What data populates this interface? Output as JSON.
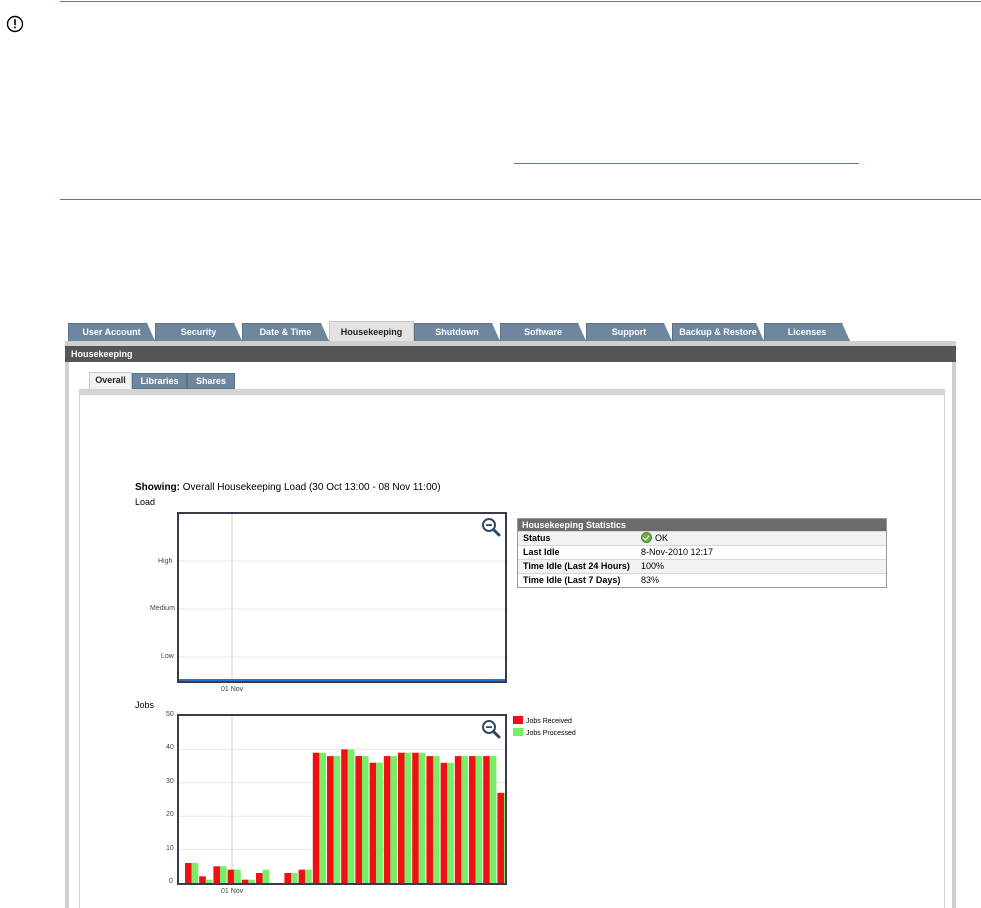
{
  "tabs": [
    "User Account",
    "Security",
    "Date & Time",
    "Housekeeping",
    "Shutdown",
    "Software",
    "Support",
    "Backup & Restore",
    "Licenses"
  ],
  "active_tab": "Housekeeping",
  "section_title": "Housekeeping",
  "sub_tabs": [
    "Overall",
    "Libraries",
    "Shares"
  ],
  "active_sub_tab": "Overall",
  "showing": {
    "label": "Showing:",
    "text": "Overall Housekeeping Load (30 Oct 13:00 - 08 Nov 11:00)"
  },
  "stats": {
    "title": "Housekeeping Statistics",
    "rows": [
      {
        "key": "Status",
        "value": "OK"
      },
      {
        "key": "Last Idle",
        "value": "8-Nov-2010 12:17"
      },
      {
        "key": "Time Idle (Last 24 Hours)",
        "value": "100%"
      },
      {
        "key": "Time Idle (Last 7 Days)",
        "value": "83%"
      }
    ]
  },
  "colors": {
    "rule": "#2a8ac7",
    "tab": "#6f879e",
    "header": "#555555",
    "received": "#ee1111",
    "processed": "#77ee66"
  },
  "chart_data": [
    {
      "type": "line",
      "ylabel": "Load",
      "y_ticks": [
        "Low",
        "Medium",
        "High"
      ],
      "x_ticks": [
        "01 Nov"
      ],
      "grid": true,
      "series": [
        {
          "values": [
            0,
            0,
            0,
            0,
            0,
            0,
            0,
            0,
            0,
            0,
            0,
            0,
            0,
            0,
            0,
            0,
            0,
            0,
            0,
            0,
            0,
            0,
            0,
            0
          ]
        }
      ]
    },
    {
      "type": "bar",
      "ylabel": "Jobs",
      "ylim": [
        0,
        50
      ],
      "y_ticks": [
        0,
        10,
        20,
        30,
        40,
        50
      ],
      "x_ticks": [
        "01 Nov"
      ],
      "grid": true,
      "legend": "right",
      "series": [
        {
          "name": "Jobs Received",
          "values": [
            6,
            2,
            5,
            4,
            1,
            3,
            0,
            3,
            4,
            39,
            38,
            40,
            38,
            36,
            38,
            39,
            39,
            38,
            36,
            38,
            38,
            38,
            27
          ]
        },
        {
          "name": "Jobs Processed",
          "values": [
            6,
            1,
            5,
            4,
            1,
            4,
            0,
            3,
            4,
            39,
            38,
            40,
            38,
            36,
            38,
            39,
            39,
            38,
            36,
            38,
            38,
            38,
            27
          ]
        }
      ]
    }
  ]
}
